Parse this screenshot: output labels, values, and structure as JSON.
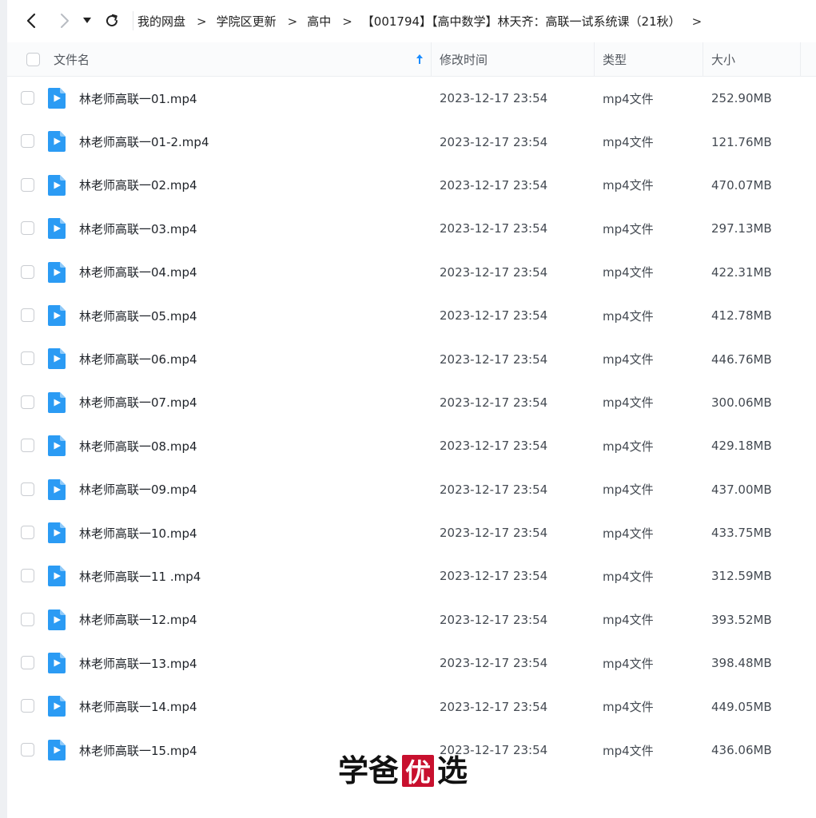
{
  "toolbar": {
    "back_icon": "chevron-left-icon",
    "forward_icon": "chevron-right-icon",
    "dropdown_icon": "caret-down-icon",
    "refresh_icon": "refresh-icon",
    "breadcrumb": [
      "我的网盘",
      "学院区更新",
      "高中",
      "【001794】【高中数学】林天齐：高联一试系统课（21秋）"
    ],
    "arrow": ">"
  },
  "header": {
    "name": "文件名",
    "date": "修改时间",
    "type": "类型",
    "size": "大小",
    "sort_icon": "sort-ascending-icon",
    "sort_color": "#1a8cff"
  },
  "files": [
    {
      "name": "林老师高联一01.mp4",
      "date": "2023-12-17 23:54",
      "type": "mp4文件",
      "size": "252.90MB"
    },
    {
      "name": "林老师高联一01-2.mp4",
      "date": "2023-12-17 23:54",
      "type": "mp4文件",
      "size": "121.76MB"
    },
    {
      "name": "林老师高联一02.mp4",
      "date": "2023-12-17 23:54",
      "type": "mp4文件",
      "size": "470.07MB"
    },
    {
      "name": "林老师高联一03.mp4",
      "date": "2023-12-17 23:54",
      "type": "mp4文件",
      "size": "297.13MB"
    },
    {
      "name": "林老师高联一04.mp4",
      "date": "2023-12-17 23:54",
      "type": "mp4文件",
      "size": "422.31MB"
    },
    {
      "name": "林老师高联一05.mp4",
      "date": "2023-12-17 23:54",
      "type": "mp4文件",
      "size": "412.78MB"
    },
    {
      "name": "林老师高联一06.mp4",
      "date": "2023-12-17 23:54",
      "type": "mp4文件",
      "size": "446.76MB"
    },
    {
      "name": "林老师高联一07.mp4",
      "date": "2023-12-17 23:54",
      "type": "mp4文件",
      "size": "300.06MB"
    },
    {
      "name": "林老师高联一08.mp4",
      "date": "2023-12-17 23:54",
      "type": "mp4文件",
      "size": "429.18MB"
    },
    {
      "name": "林老师高联一09.mp4",
      "date": "2023-12-17 23:54",
      "type": "mp4文件",
      "size": "437.00MB"
    },
    {
      "name": "林老师高联一10.mp4",
      "date": "2023-12-17 23:54",
      "type": "mp4文件",
      "size": "433.75MB"
    },
    {
      "name": "林老师高联一11 .mp4",
      "date": "2023-12-17 23:54",
      "type": "mp4文件",
      "size": "312.59MB"
    },
    {
      "name": "林老师高联一12.mp4",
      "date": "2023-12-17 23:54",
      "type": "mp4文件",
      "size": "393.52MB"
    },
    {
      "name": "林老师高联一13.mp4",
      "date": "2023-12-17 23:54",
      "type": "mp4文件",
      "size": "398.48MB"
    },
    {
      "name": "林老师高联一14.mp4",
      "date": "2023-12-17 23:54",
      "type": "mp4文件",
      "size": "449.05MB"
    },
    {
      "name": "林老师高联一15.mp4",
      "date": "2023-12-17 23:54",
      "type": "mp4文件",
      "size": "436.06MB"
    }
  ],
  "file_icon": "video-file-icon",
  "file_icon_color": "#2b9bf4",
  "watermark": {
    "chars": [
      "学",
      "爸",
      "优",
      "选"
    ],
    "seal_color": "#c8102e"
  }
}
